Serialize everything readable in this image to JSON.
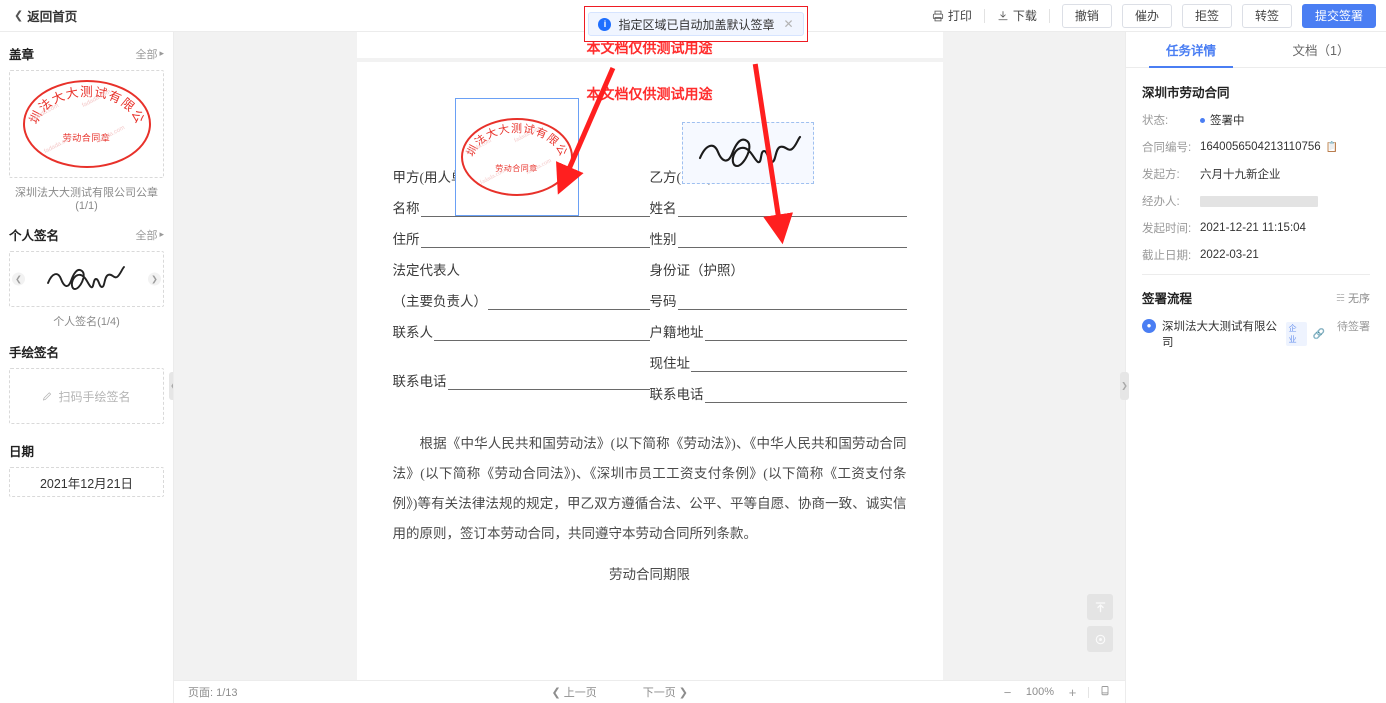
{
  "topbar": {
    "back_label": "返回首页",
    "print_label": "打印",
    "download_label": "下载",
    "revoke_label": "撤销",
    "urge_label": "催办",
    "reject_label": "拒签",
    "transfer_label": "转签",
    "submit_label": "提交签署"
  },
  "notification": {
    "text": "指定区域已自动加盖默认签章",
    "close": "✕"
  },
  "sidebar": {
    "seal_section": {
      "title": "盖章",
      "all_label": "全部"
    },
    "seal_item": {
      "caption": "深圳法大大测试有限公司公章(1/1)",
      "ring_text": "深圳法大大测试有限公司",
      "center_text": "劳动合同章",
      "watermark": "fadada.com"
    },
    "personal_section": {
      "title": "个人签名",
      "all_label": "全部"
    },
    "personal_item": {
      "caption": "个人签名(1/4)"
    },
    "hand_section": {
      "title": "手绘签名"
    },
    "hand_item": {
      "label": "扫码手绘签名"
    },
    "date_section": {
      "title": "日期"
    },
    "date_item": {
      "value": "2021年12月21日"
    }
  },
  "document": {
    "watermark_top": "本文档仅供测试用途",
    "watermark_in": "本文档仅供测试用途",
    "party_a": {
      "title": "甲方(用人单位)",
      "fields": [
        {
          "label": "名称",
          "type": "rule"
        },
        {
          "label": "住所",
          "type": "rule"
        },
        {
          "label": "法定代表人",
          "type": "plain"
        },
        {
          "label": "（主要负责人）",
          "type": "rule"
        },
        {
          "label": "联系人",
          "type": "rule"
        },
        {
          "label": "",
          "type": "gap"
        },
        {
          "label": "联系电话",
          "type": "rule"
        }
      ]
    },
    "party_b": {
      "title": "乙方(员工)",
      "fields": [
        {
          "label": "姓名",
          "type": "rule"
        },
        {
          "label": "性别",
          "type": "rule"
        },
        {
          "label": "身份证（护照）",
          "type": "plain"
        },
        {
          "label": "号码",
          "type": "rule"
        },
        {
          "label": "户籍地址",
          "type": "rule"
        },
        {
          "label": "现住址",
          "type": "rule"
        },
        {
          "label": "联系电话",
          "type": "rule"
        }
      ]
    },
    "body_paragraph": "根据《中华人民共和国劳动法》(以下简称《劳动法》)、《中华人民共和国劳动合同法》(以下简称《劳动合同法》)、《深圳市员工工资支付条例》(以下简称《工资支付条例》)等有关法律法规的规定，甲乙双方遵循合法、公平、平等自愿、协商一致、诚实信用的原则，签订本劳动合同，共同遵守本劳动合同所列条款。",
    "chapter": "劳动合同期限"
  },
  "bottombar": {
    "page_label": "页面: 1/13",
    "prev_label": "上一页",
    "next_label": "下一页",
    "zoom_out": "−",
    "zoom_value": "100%",
    "zoom_in": "+"
  },
  "rightpanel": {
    "tabs": [
      {
        "label": "任务详情",
        "active": true
      },
      {
        "label": "文档（1）",
        "active": false
      }
    ],
    "doc_title": "深圳市劳动合同",
    "details": [
      {
        "key": "状态:",
        "value": "签署中",
        "dot": true
      },
      {
        "key": "合同编号:",
        "value": "1640056504213110756",
        "copy": true
      },
      {
        "key": "发起方:",
        "value": "六月十九新企业"
      },
      {
        "key": "经办人:",
        "value": "",
        "redacted": true
      },
      {
        "key": "发起时间:",
        "value": "2021-12-21 11:15:04"
      },
      {
        "key": "截止日期:",
        "value": "2022-03-21"
      }
    ],
    "flow": {
      "title": "签署流程",
      "mode_label": "无序",
      "participant_name": "深圳法大大测试有限公司",
      "participant_badge": "企业",
      "participant_status": "待签署"
    }
  },
  "colors": {
    "primary": "#4a7ef3",
    "seal_red": "#e8312a",
    "annotation_red": "#ff2d2d",
    "page_bg": "#f2f2f2"
  }
}
